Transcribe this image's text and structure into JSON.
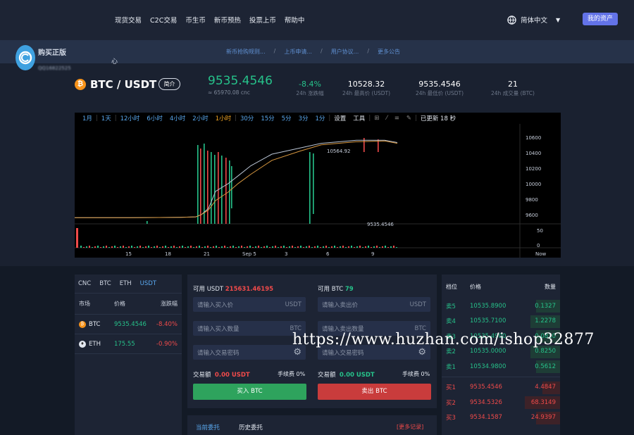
{
  "nav": {
    "items": [
      "现货交易",
      "C2C交易",
      "币生币",
      "新币预热",
      "投票上币",
      "帮助中"
    ],
    "language": "简体中文",
    "assets_button": "我的资产"
  },
  "notice": {
    "items": [
      "新币抢购规则...",
      "上币申请...",
      "用户协议...",
      "更多公告"
    ]
  },
  "brand": {
    "title": "购买正版",
    "subtitle": "QQ16822525",
    "mark": "心"
  },
  "ticker": {
    "pair": "BTC / USDT",
    "intro_button": "简介",
    "last_price": "9535.4546",
    "last_price_cny": "≈ 65970.08 cnc",
    "change": "-8.4%",
    "change_label": "24h 涨跌幅",
    "high": "10528.32",
    "high_label": "24h 最高价 (USDT)",
    "low": "9535.4546",
    "low_label": "24h 最低价 (USDT)",
    "volume": "21",
    "volume_label": "24h 成交量 (BTC)"
  },
  "chart_toolbar": {
    "intervals": [
      "1月",
      "1天",
      "12小时",
      "6小时",
      "4小时",
      "2小时",
      "1小时",
      "30分",
      "15分",
      "5分",
      "3分",
      "1分"
    ],
    "selected": "1小时",
    "settings": "设置",
    "tools": "工具",
    "updated": "已更新 18 秒"
  },
  "chart_data": {
    "type": "line",
    "ylabel_ticks": [
      10600,
      10400,
      10200,
      10000,
      9800,
      9600
    ],
    "volume_ticks": [
      50,
      0
    ],
    "x_ticks": [
      "15",
      "18",
      "21",
      "Sep 5",
      "3",
      "6",
      "9",
      "Now"
    ],
    "ylim": [
      9480,
      10680
    ],
    "price_label": "9535.4546",
    "high_label": "10564.92",
    "series": [
      {
        "values": [
          9560,
          9560,
          9560,
          9562,
          9565,
          9570,
          9600,
          9680,
          9900,
          10000,
          10100,
          10230,
          10380,
          10460,
          10520,
          10560,
          10560,
          10530
        ]
      },
      {
        "values": [
          9560,
          9560,
          9560,
          9562,
          9565,
          9570,
          9600,
          9660,
          9780,
          9890,
          10000,
          10120,
          10300,
          10420,
          10500,
          10540,
          10550,
          10520
        ]
      }
    ]
  },
  "markets": {
    "tabs": [
      "CNC",
      "BTC",
      "ETH",
      "USDT"
    ],
    "selected": "USDT",
    "headers": [
      "市场",
      "价格",
      "涨跌幅"
    ],
    "rows": [
      {
        "symbol": "BTC",
        "price": "9535.4546",
        "change": "-8.40%"
      },
      {
        "symbol": "ETH",
        "price": "175.55",
        "change": "-0.90%"
      }
    ]
  },
  "order": {
    "buy": {
      "available_label": "可用 USDT",
      "available": "215631.46195",
      "price_placeholder": "请输入买入价",
      "price_unit": "USDT",
      "qty_placeholder": "请输入买入数量",
      "qty_unit": "BTC",
      "pwd_placeholder": "请输入交易密码",
      "amount_label": "交易额",
      "amount": "0.00 USDT",
      "fee": "手续费 0%",
      "button": "买入 BTC"
    },
    "sell": {
      "available_label": "可用 BTC",
      "available": "79",
      "price_placeholder": "请输入卖出价",
      "price_unit": "USDT",
      "qty_placeholder": "请输入卖出数量",
      "qty_unit": "BTC",
      "pwd_placeholder": "请输入交易密码",
      "amount_label": "交易额",
      "amount": "0.00 USDT",
      "fee": "手续费 0%",
      "button": "卖出 BTC"
    }
  },
  "entrust": {
    "current": "当前委托",
    "history": "历史委托",
    "more": "[更多记录]"
  },
  "book": {
    "headers": [
      "档位",
      "价格",
      "数量"
    ],
    "sells": [
      {
        "level": "卖5",
        "price": "10535.8900",
        "qty": "0.1327",
        "fill": 0.2
      },
      {
        "level": "卖4",
        "price": "10535.7100",
        "qty": "1.2278",
        "fill": 0.25
      },
      {
        "level": "卖3",
        "price": "10535.4900",
        "qty": "0.0810",
        "fill": 0.2
      },
      {
        "level": "卖2",
        "price": "10535.0000",
        "qty": "0.8250",
        "fill": 0.25
      },
      {
        "level": "卖1",
        "price": "10534.9800",
        "qty": "0.5612",
        "fill": 0.2
      }
    ],
    "buys": [
      {
        "level": "买1",
        "price": "9535.4546",
        "qty": "4.4847",
        "fill": 0.15
      },
      {
        "level": "买2",
        "price": "9534.5326",
        "qty": "68.3149",
        "fill": 0.3
      },
      {
        "level": "买3",
        "price": "9534.1587",
        "qty": "24.9397",
        "fill": 0.2
      }
    ]
  },
  "watermark": "https://www.huzhan.com/ishop32877",
  "colors": {
    "up": "#26c28a",
    "down": "#f04a4a",
    "accent": "#5aa9f0",
    "brand": "#6373e8"
  }
}
